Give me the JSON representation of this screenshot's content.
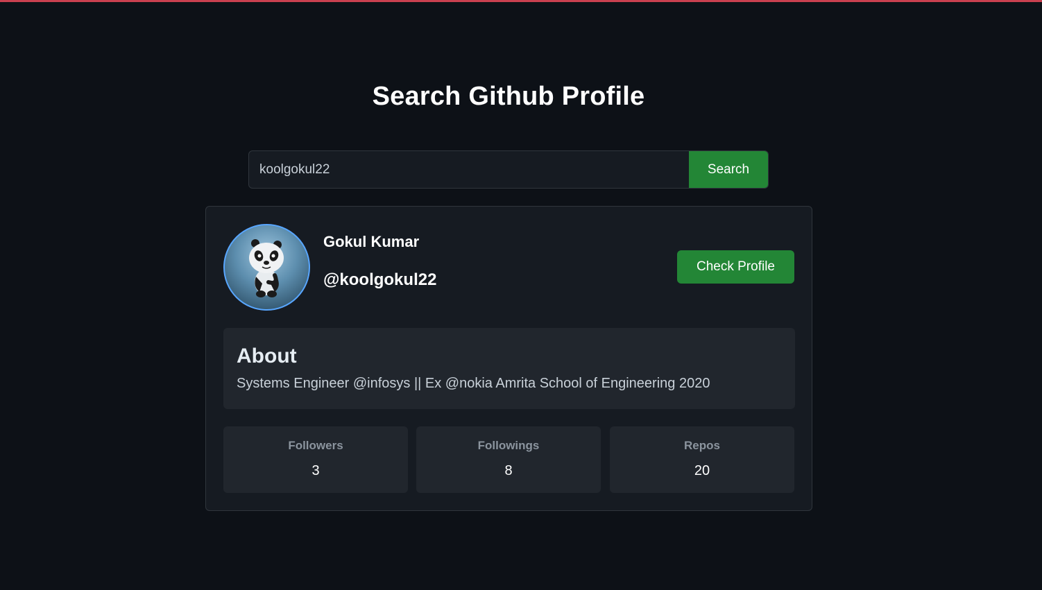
{
  "colors": {
    "background": "#0d1117",
    "card": "#161b22",
    "panel": "#21262d",
    "accent_green": "#238636",
    "top_bar": "#c9404f",
    "avatar_ring": "#58a6ff"
  },
  "page": {
    "title": "Search Github Profile"
  },
  "search": {
    "value": "koolgokul22",
    "button_label": "Search"
  },
  "profile": {
    "avatar_icon": "panda-avatar-icon",
    "name": "Gokul Kumar",
    "handle": "@koolgokul22",
    "check_profile_label": "Check Profile",
    "about": {
      "heading": "About",
      "bio": "Systems Engineer @infosys || Ex @nokia Amrita School of Engineering 2020"
    },
    "stats": [
      {
        "label": "Followers",
        "value": "3"
      },
      {
        "label": "Followings",
        "value": "8"
      },
      {
        "label": "Repos",
        "value": "20"
      }
    ]
  }
}
